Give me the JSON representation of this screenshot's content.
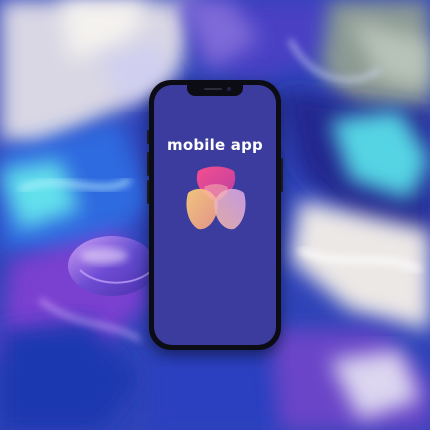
{
  "screen": {
    "title": "mobile app",
    "background_color": "#3c3c9e"
  },
  "logo": {
    "icon": "petal-flower-icon",
    "colors": [
      "#e8458c",
      "#f2a0a8",
      "#f6c88a",
      "#c2a0e0"
    ]
  },
  "background": {
    "description_colors": [
      "#1f3fb8",
      "#6a3ec8",
      "#36c6e8",
      "#f0ede8",
      "#8fa0a0"
    ]
  }
}
